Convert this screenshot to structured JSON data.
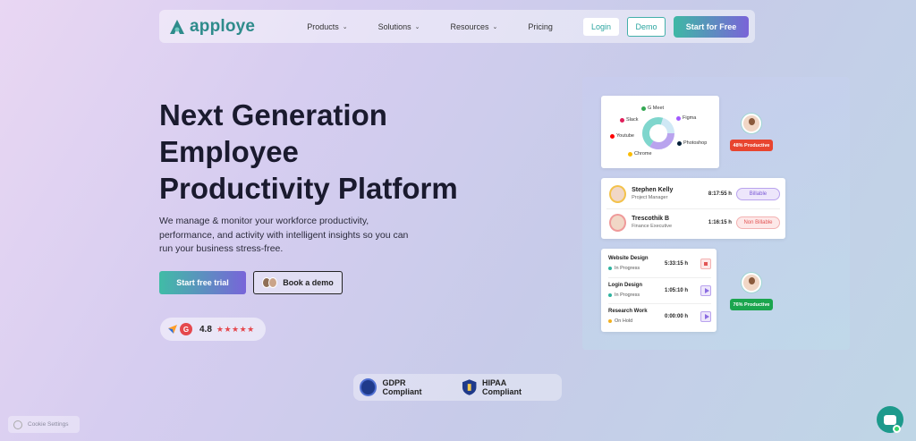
{
  "nav": {
    "brand": "apploye",
    "menu": [
      {
        "label": "Products",
        "dropdown": true
      },
      {
        "label": "Solutions",
        "dropdown": true
      },
      {
        "label": "Resources",
        "dropdown": true
      },
      {
        "label": "Pricing",
        "dropdown": false
      }
    ],
    "login_label": "Login",
    "demo_label": "Demo",
    "start_free_label": "Start for Free"
  },
  "hero": {
    "title_lines": [
      "Next Generation",
      "Employee",
      "Productivity Platform"
    ],
    "description": "We manage & monitor your workforce productivity, performance, and activity with intelligent insights so you can run your business stress-free.",
    "trial_label": "Start free trial",
    "book_demo_label": "Book a demo"
  },
  "rating": {
    "g_letter": "G",
    "value": "4.8",
    "stars": "★★★★★"
  },
  "compliance": {
    "gdpr_label": "GDPR Compliant",
    "hipaa_label": "HIPAA Compliant"
  },
  "illustration": {
    "apps": [
      "G Meet",
      "Slack",
      "Figma",
      "Youtube",
      "Photoshop",
      "Chrome"
    ],
    "people": [
      {
        "name": "Stephen Kelly",
        "role": "Project Manager",
        "time": "8:17:55 h",
        "tag": "Billable"
      },
      {
        "name": "Trescothik B",
        "role": "Finance Executive",
        "time": "1:16:15 h",
        "tag": "Non Billable"
      }
    ],
    "tasks": [
      {
        "name": "Website Design",
        "status": "In Progress",
        "time": "5:33:15 h"
      },
      {
        "name": "Login Design",
        "status": "In Progress",
        "time": "1:05:10 h"
      },
      {
        "name": "Research Work",
        "status": "On Hold",
        "time": "0:00:00 h"
      }
    ],
    "badge_top": "48% Productive",
    "badge_bottom": "76% Productive"
  },
  "footer": {
    "cookie_label": "Cookie Settings"
  },
  "colors": {
    "brand_teal": "#2e8b8b",
    "accent_purple": "#7a64d8",
    "billable": "#7b5ad6",
    "non_billable": "#e25555"
  }
}
